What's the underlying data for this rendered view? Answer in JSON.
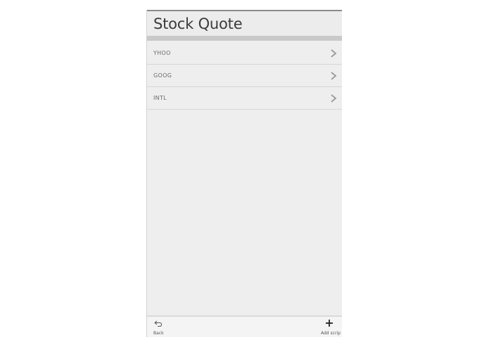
{
  "app": {
    "title": "Stock Quote"
  },
  "list": {
    "items": [
      {
        "symbol": "YHOO"
      },
      {
        "symbol": "GOOG"
      },
      {
        "symbol": "INTL"
      }
    ],
    "item_icon": "chevron-right-icon"
  },
  "toolbar": {
    "back_label": "Back",
    "back_icon": "back-arrow-icon",
    "add_label": "Add scrip",
    "add_icon": "plus-icon"
  },
  "colors": {
    "background": "#eeeeee",
    "title_text": "#3b3b3b",
    "separator_bar": "#c9c9c9"
  }
}
